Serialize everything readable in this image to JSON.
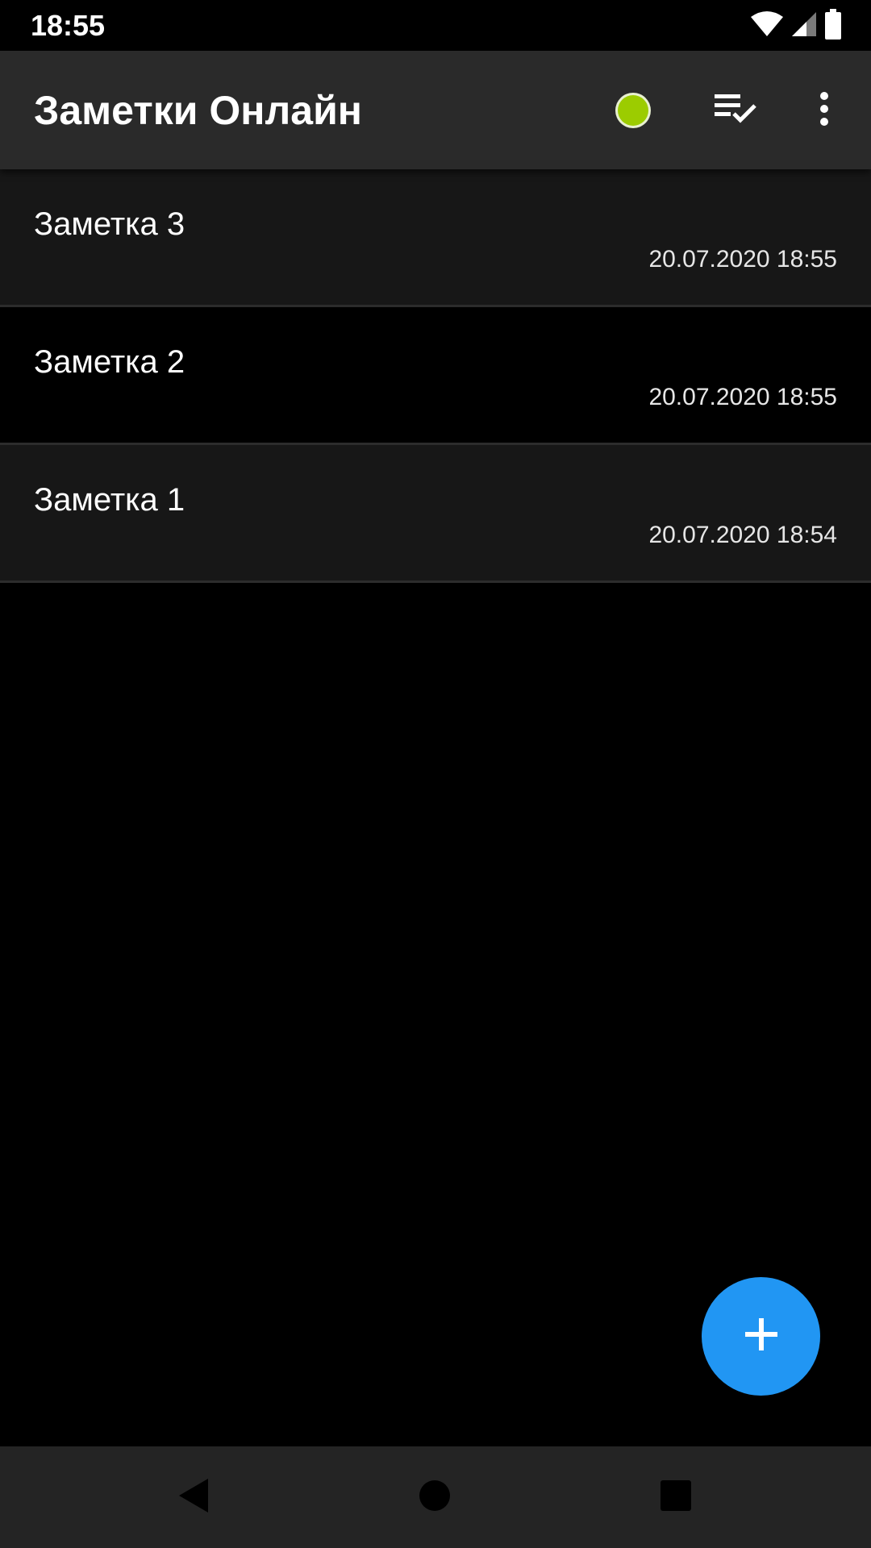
{
  "status_bar": {
    "time": "18:55",
    "icons": [
      "wifi-icon",
      "cellular-signal-icon",
      "battery-icon"
    ]
  },
  "app_bar": {
    "title": "Заметки Онлайн",
    "status_dot_color": "#9ccc00",
    "actions": [
      "checklist-icon",
      "more-vert-icon"
    ]
  },
  "notes": [
    {
      "title": "Заметка 3",
      "date": "20.07.2020 18:55"
    },
    {
      "title": "Заметка 2",
      "date": "20.07.2020 18:55"
    },
    {
      "title": "Заметка 1",
      "date": "20.07.2020 18:54"
    }
  ],
  "fab": {
    "icon": "plus-icon",
    "color": "#2196f3"
  },
  "nav_bar": {
    "buttons": [
      "back-icon",
      "home-icon",
      "recents-icon"
    ]
  },
  "colors": {
    "background": "#000000",
    "app_bar": "#2a2a2a",
    "row_alt": "#171717",
    "nav_bar": "#242424"
  }
}
